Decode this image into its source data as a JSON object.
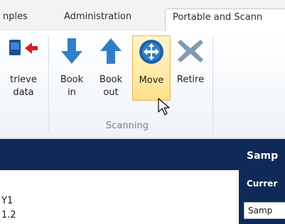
{
  "tabs": [
    {
      "label": "nples"
    },
    {
      "label": "Administration"
    },
    {
      "label": "Portable and Scann"
    }
  ],
  "ribbon": {
    "buttons": [
      {
        "id": "retrieve",
        "lines": [
          "trieve",
          "data"
        ],
        "icon": "retrieve-data-icon"
      },
      {
        "id": "bookin",
        "lines": [
          "Book",
          "in"
        ],
        "icon": "arrow-down-icon"
      },
      {
        "id": "bookout",
        "lines": [
          "Book",
          "out"
        ],
        "icon": "arrow-up-icon"
      },
      {
        "id": "move",
        "lines": [
          "Move"
        ],
        "icon": "move-icon"
      },
      {
        "id": "retire",
        "lines": [
          "Retire"
        ],
        "icon": "retire-x-icon"
      }
    ],
    "group_label": "Scanning"
  },
  "header": {
    "title": "Samp"
  },
  "left_rows": [
    "Y1",
    "1.2"
  ],
  "right_panel": {
    "current_label": "Currer",
    "field_value": "Samp"
  },
  "colors": {
    "band": "#102a57",
    "accent_blue": "#2f7fc8",
    "hover": "#ffe08a"
  }
}
